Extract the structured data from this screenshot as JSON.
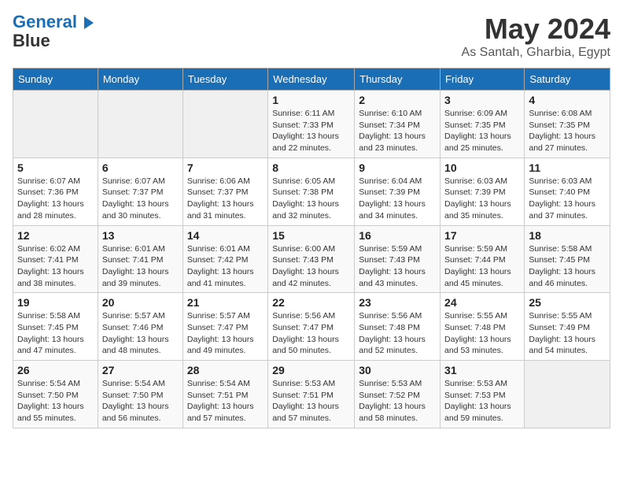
{
  "logo": {
    "line1": "General",
    "line2": "Blue"
  },
  "title": "May 2024",
  "location": "As Santah, Gharbia, Egypt",
  "headers": [
    "Sunday",
    "Monday",
    "Tuesday",
    "Wednesday",
    "Thursday",
    "Friday",
    "Saturday"
  ],
  "weeks": [
    [
      {
        "day": "",
        "info": ""
      },
      {
        "day": "",
        "info": ""
      },
      {
        "day": "",
        "info": ""
      },
      {
        "day": "1",
        "info": "Sunrise: 6:11 AM\nSunset: 7:33 PM\nDaylight: 13 hours and 22 minutes."
      },
      {
        "day": "2",
        "info": "Sunrise: 6:10 AM\nSunset: 7:34 PM\nDaylight: 13 hours and 23 minutes."
      },
      {
        "day": "3",
        "info": "Sunrise: 6:09 AM\nSunset: 7:35 PM\nDaylight: 13 hours and 25 minutes."
      },
      {
        "day": "4",
        "info": "Sunrise: 6:08 AM\nSunset: 7:35 PM\nDaylight: 13 hours and 27 minutes."
      }
    ],
    [
      {
        "day": "5",
        "info": "Sunrise: 6:07 AM\nSunset: 7:36 PM\nDaylight: 13 hours and 28 minutes."
      },
      {
        "day": "6",
        "info": "Sunrise: 6:07 AM\nSunset: 7:37 PM\nDaylight: 13 hours and 30 minutes."
      },
      {
        "day": "7",
        "info": "Sunrise: 6:06 AM\nSunset: 7:37 PM\nDaylight: 13 hours and 31 minutes."
      },
      {
        "day": "8",
        "info": "Sunrise: 6:05 AM\nSunset: 7:38 PM\nDaylight: 13 hours and 32 minutes."
      },
      {
        "day": "9",
        "info": "Sunrise: 6:04 AM\nSunset: 7:39 PM\nDaylight: 13 hours and 34 minutes."
      },
      {
        "day": "10",
        "info": "Sunrise: 6:03 AM\nSunset: 7:39 PM\nDaylight: 13 hours and 35 minutes."
      },
      {
        "day": "11",
        "info": "Sunrise: 6:03 AM\nSunset: 7:40 PM\nDaylight: 13 hours and 37 minutes."
      }
    ],
    [
      {
        "day": "12",
        "info": "Sunrise: 6:02 AM\nSunset: 7:41 PM\nDaylight: 13 hours and 38 minutes."
      },
      {
        "day": "13",
        "info": "Sunrise: 6:01 AM\nSunset: 7:41 PM\nDaylight: 13 hours and 39 minutes."
      },
      {
        "day": "14",
        "info": "Sunrise: 6:01 AM\nSunset: 7:42 PM\nDaylight: 13 hours and 41 minutes."
      },
      {
        "day": "15",
        "info": "Sunrise: 6:00 AM\nSunset: 7:43 PM\nDaylight: 13 hours and 42 minutes."
      },
      {
        "day": "16",
        "info": "Sunrise: 5:59 AM\nSunset: 7:43 PM\nDaylight: 13 hours and 43 minutes."
      },
      {
        "day": "17",
        "info": "Sunrise: 5:59 AM\nSunset: 7:44 PM\nDaylight: 13 hours and 45 minutes."
      },
      {
        "day": "18",
        "info": "Sunrise: 5:58 AM\nSunset: 7:45 PM\nDaylight: 13 hours and 46 minutes."
      }
    ],
    [
      {
        "day": "19",
        "info": "Sunrise: 5:58 AM\nSunset: 7:45 PM\nDaylight: 13 hours and 47 minutes."
      },
      {
        "day": "20",
        "info": "Sunrise: 5:57 AM\nSunset: 7:46 PM\nDaylight: 13 hours and 48 minutes."
      },
      {
        "day": "21",
        "info": "Sunrise: 5:57 AM\nSunset: 7:47 PM\nDaylight: 13 hours and 49 minutes."
      },
      {
        "day": "22",
        "info": "Sunrise: 5:56 AM\nSunset: 7:47 PM\nDaylight: 13 hours and 50 minutes."
      },
      {
        "day": "23",
        "info": "Sunrise: 5:56 AM\nSunset: 7:48 PM\nDaylight: 13 hours and 52 minutes."
      },
      {
        "day": "24",
        "info": "Sunrise: 5:55 AM\nSunset: 7:48 PM\nDaylight: 13 hours and 53 minutes."
      },
      {
        "day": "25",
        "info": "Sunrise: 5:55 AM\nSunset: 7:49 PM\nDaylight: 13 hours and 54 minutes."
      }
    ],
    [
      {
        "day": "26",
        "info": "Sunrise: 5:54 AM\nSunset: 7:50 PM\nDaylight: 13 hours and 55 minutes."
      },
      {
        "day": "27",
        "info": "Sunrise: 5:54 AM\nSunset: 7:50 PM\nDaylight: 13 hours and 56 minutes."
      },
      {
        "day": "28",
        "info": "Sunrise: 5:54 AM\nSunset: 7:51 PM\nDaylight: 13 hours and 57 minutes."
      },
      {
        "day": "29",
        "info": "Sunrise: 5:53 AM\nSunset: 7:51 PM\nDaylight: 13 hours and 57 minutes."
      },
      {
        "day": "30",
        "info": "Sunrise: 5:53 AM\nSunset: 7:52 PM\nDaylight: 13 hours and 58 minutes."
      },
      {
        "day": "31",
        "info": "Sunrise: 5:53 AM\nSunset: 7:53 PM\nDaylight: 13 hours and 59 minutes."
      },
      {
        "day": "",
        "info": ""
      }
    ]
  ]
}
